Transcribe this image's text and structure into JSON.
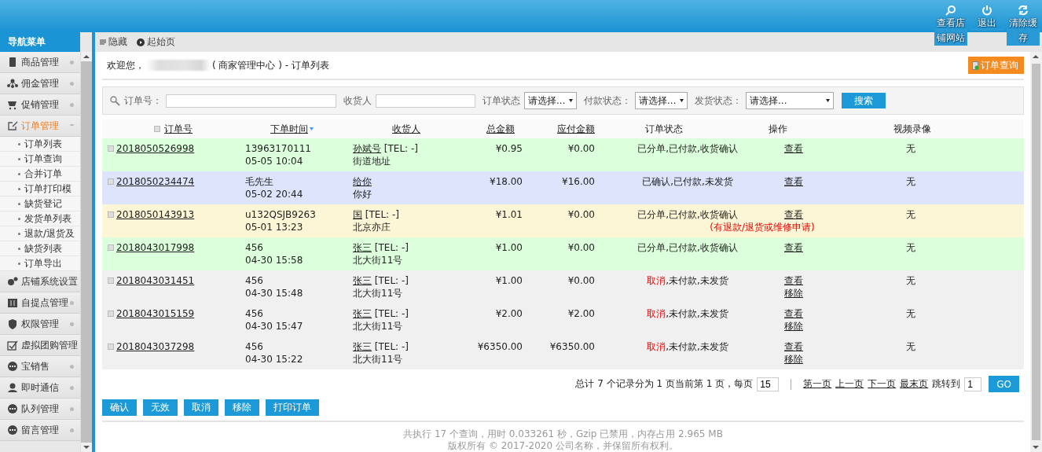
{
  "header": {
    "actions": [
      {
        "kind": "search",
        "label": "查看店铺网站"
      },
      {
        "kind": "power",
        "label": "退出"
      },
      {
        "kind": "refresh",
        "label": "清除缓存"
      }
    ]
  },
  "sidebar": {
    "title": "导航菜单",
    "items": [
      {
        "kind": "goods",
        "label": "商品管理",
        "expanded": false
      },
      {
        "kind": "tree",
        "label": "佣金管理",
        "expanded": false
      },
      {
        "kind": "cart",
        "label": "促销管理",
        "expanded": false
      },
      {
        "kind": "edit",
        "label": "订单管理",
        "expanded": true,
        "children": [
          {
            "label": "订单列表"
          },
          {
            "label": "订单查询"
          },
          {
            "label": "合并订单"
          },
          {
            "label": "订单打印模"
          },
          {
            "label": "缺货登记"
          },
          {
            "label": "发货单列表"
          },
          {
            "label": "退款/退货及"
          },
          {
            "label": "缺货列表"
          },
          {
            "label": "订单导出"
          }
        ]
      },
      {
        "kind": "gears",
        "label": "店铺系统设置",
        "expanded": false
      },
      {
        "kind": "columns",
        "label": "自提点管理",
        "expanded": false
      },
      {
        "kind": "shield",
        "label": "权限管理",
        "expanded": false
      },
      {
        "kind": "check",
        "label": "虚拟团购管理",
        "expanded": false
      },
      {
        "kind": "dots",
        "label": "宝销售",
        "expanded": false
      },
      {
        "kind": "person",
        "label": "即时通信",
        "expanded": false
      },
      {
        "kind": "dots",
        "label": "队列管理",
        "expanded": false
      },
      {
        "kind": "dots",
        "label": "留言管理",
        "expanded": false
      }
    ]
  },
  "toolbar": {
    "hide": "隐藏",
    "home": "起始页"
  },
  "welcome": {
    "greeting": "欢迎您，",
    "suffix": "( 商家管理中心 ) - 订单列表",
    "button": "订单查询"
  },
  "search": {
    "fields": [
      {
        "kind": "text",
        "label": "订单号："
      },
      {
        "kind": "text",
        "label": "收货人"
      },
      {
        "kind": "select",
        "label": "订单状态",
        "value": "请选择..."
      },
      {
        "kind": "select",
        "label": "付款状态：",
        "value": "请选择..."
      },
      {
        "kind": "wideselect",
        "label": "发货状态：",
        "value": "请选择..."
      }
    ],
    "button": "搜索"
  },
  "table": {
    "select_all": {
      "checked": false
    },
    "columns": [
      "订单号",
      "下单时间",
      "收货人",
      "总金额",
      "应付金额",
      "订单状态",
      "操作",
      "视频录像"
    ],
    "rows": [
      {
        "color": "#dcffdc",
        "order": "2018050526998",
        "buyer": "13963170111",
        "time": "05-05 10:04",
        "consignee": "孙斌号",
        "tel": "[TEL: -]",
        "address": "街道地址",
        "total": "¥0.95",
        "payable": "¥0.00",
        "status": [
          {
            "text": "已分单,已付款,收货确认",
            "alert": false
          }
        ],
        "actions": [
          "查看"
        ],
        "video": "无"
      },
      {
        "color": "#dde4fb",
        "order": "2018050234474",
        "buyer": "毛先生",
        "time": "05-02 20:44",
        "consignee": "给你",
        "tel": "",
        "address": "你好",
        "total": "¥18.00",
        "payable": "¥16.00",
        "status": [
          {
            "text": "已确认,已付款,未发货",
            "alert": false
          }
        ],
        "actions": [
          "查看"
        ],
        "video": "无"
      },
      {
        "color": "#fdf6d6",
        "order": "2018050143913",
        "buyer": "u132QSJB9263",
        "time": "05-01 13:23",
        "consignee": "国",
        "tel": "[TEL: -]",
        "address": "北京亦庄",
        "total": "¥1.01",
        "payable": "¥0.00",
        "status": [
          {
            "text": "已分单,已付款,收货确认",
            "alert": false
          }
        ],
        "actions": [
          "查看"
        ],
        "note": "(有退款/退货或维修申请)",
        "video": "无"
      },
      {
        "color": "#dcffdc",
        "order": "2018043017998",
        "buyer": "456",
        "time": "04-30 15:58",
        "consignee": "张三",
        "tel": "[TEL: -]",
        "address": "北大街11号",
        "total": "¥1.00",
        "payable": "¥0.00",
        "status": [
          {
            "text": "已分单,已付款,收货确认",
            "alert": false
          }
        ],
        "actions": [
          "查看"
        ],
        "video": "无"
      },
      {
        "color": "#f0f0f0",
        "order": "2018043031451",
        "buyer": "456",
        "time": "04-30 15:48",
        "consignee": "张三",
        "tel": "[TEL: -]",
        "address": "北大街11号",
        "total": "¥1.00",
        "payable": "¥0.00",
        "status": [
          {
            "text": "取消",
            "alert": true
          },
          {
            "text": ",未付款,未发货",
            "alert": false
          }
        ],
        "actions": [
          "查看",
          "移除"
        ],
        "video": "无"
      },
      {
        "color": "#f0f0f0",
        "order": "2018043015159",
        "buyer": "456",
        "time": "04-30 15:47",
        "consignee": "张三",
        "tel": "[TEL: -]",
        "address": "北大街11号",
        "total": "¥2.00",
        "payable": "¥2.00",
        "status": [
          {
            "text": "取消",
            "alert": true
          },
          {
            "text": ",未付款,未发货",
            "alert": false
          }
        ],
        "actions": [
          "查看",
          "移除"
        ],
        "video": "无"
      },
      {
        "color": "#f0f0f0",
        "order": "2018043037298",
        "buyer": "456",
        "time": "04-30 15:22",
        "consignee": "张三",
        "tel": "[TEL: -]",
        "address": "北大街11号",
        "total": "¥6350.00",
        "payable": "¥6350.00",
        "status": [
          {
            "text": "取消",
            "alert": true
          },
          {
            "text": ",未付款,未发货",
            "alert": false
          }
        ],
        "actions": [
          "查看",
          "移除"
        ],
        "video": "无"
      }
    ]
  },
  "pagination": {
    "summary": "总计 7 个记录分为 1 页当前第 1 页，每页",
    "per_page": "15",
    "links": [
      "第一页",
      "上一页",
      "下一页",
      "最末页"
    ],
    "jump_label": "跳转到",
    "jump_value": "1",
    "go": "GO"
  },
  "bulk_actions": [
    "确认",
    "无效",
    "取消",
    "移除",
    "打印订单"
  ],
  "footer": [
    "共执行 17 个查询，用时 0.033261 秒，Gzip 已禁用，内存占用 2.965 MB",
    "版权所有 © 2017-2020 公司名称，并保留所有权利。"
  ]
}
